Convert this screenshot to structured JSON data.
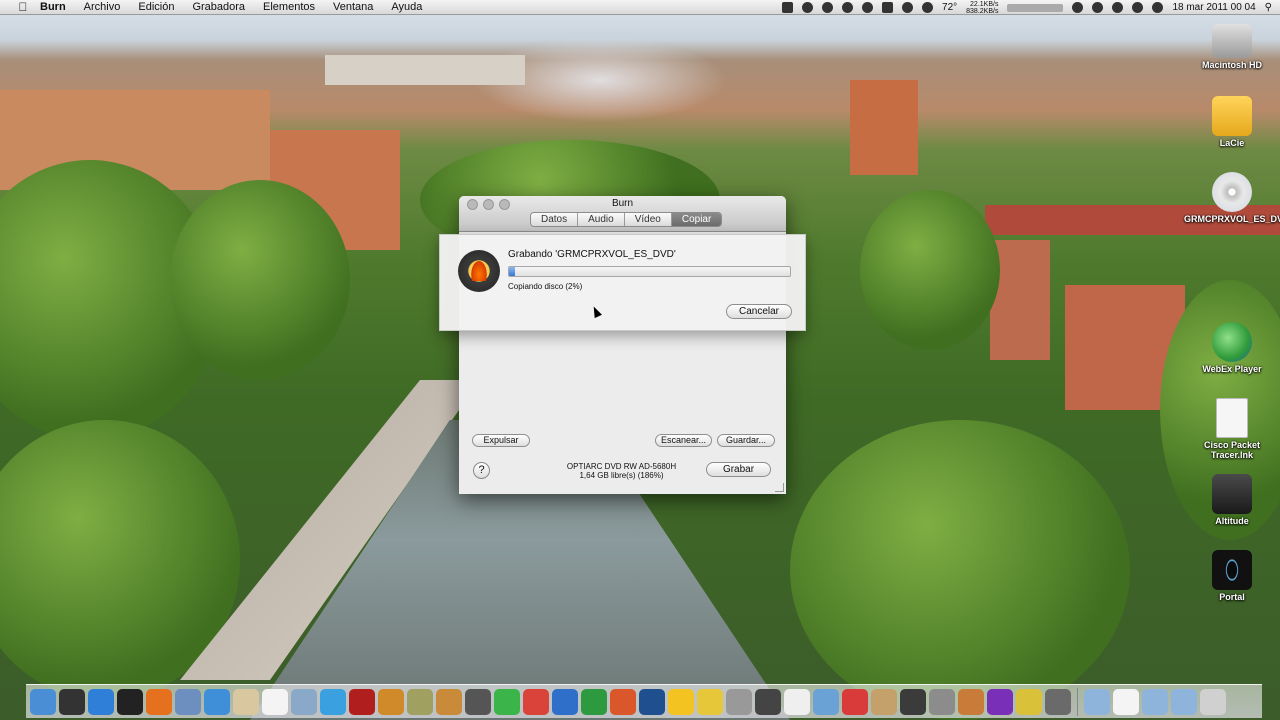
{
  "menubar": {
    "app_name": "Burn",
    "menus": [
      "Archivo",
      "Edición",
      "Grabadora",
      "Elementos",
      "Ventana",
      "Ayuda"
    ],
    "temperature": "72°",
    "net_up": "22.1KB/s",
    "net_down": "838.2KB/s",
    "clock": "18 mar 2011 00 04"
  },
  "desktop_icons": [
    {
      "label": "Macintosh HD",
      "icon": "hard-drive-icon",
      "color": "#c9c9c9"
    },
    {
      "label": "LaCie",
      "icon": "external-drive-icon",
      "color": "#f2c230"
    },
    {
      "label": "GRMCPRXVOL_ES_DVD",
      "icon": "dvd-disc-icon",
      "color": "#e0e0e0"
    },
    {
      "label": "WebEx Player",
      "icon": "webex-icon",
      "color": "#3b9e3e"
    },
    {
      "label": "Cisco Packet Tracer.lnk",
      "icon": "document-icon",
      "color": "#f4f4f4"
    },
    {
      "label": "Altitude",
      "icon": "steam-icon",
      "color": "#2b2b2b"
    },
    {
      "label": "Portal",
      "icon": "portal-icon",
      "color": "#1a1a1a"
    }
  ],
  "burn_window": {
    "title": "Burn",
    "tabs": [
      "Datos",
      "Audio",
      "Vídeo",
      "Copiar"
    ],
    "active_tab": "Copiar",
    "eject_label": "Expulsar",
    "scan_label": "Escanear...",
    "save_label": "Guardar...",
    "help_label": "?",
    "drive_name": "OPTIARC DVD RW AD-5680H",
    "drive_free": "1,64 GB libre(s) (186%)",
    "burn_label": "Grabar"
  },
  "progress_sheet": {
    "title": "Grabando 'GRMCPRXVOL_ES_DVD'",
    "status": "Copiando disco (2%)",
    "progress_percent": 2,
    "cancel_label": "Cancelar"
  },
  "dock": {
    "items": [
      {
        "name": "finder-icon",
        "color": "#4a8fd6"
      },
      {
        "name": "dashboard-icon",
        "color": "#333333"
      },
      {
        "name": "app-store-icon",
        "color": "#2f7fd8"
      },
      {
        "name": "steam-dock-icon",
        "color": "#222222"
      },
      {
        "name": "firefox-icon",
        "color": "#e5711f"
      },
      {
        "name": "preview-icon",
        "color": "#6d8fbf"
      },
      {
        "name": "safari-icon",
        "color": "#3f8ed8"
      },
      {
        "name": "script-icon",
        "color": "#d9c7a0"
      },
      {
        "name": "calendar-icon",
        "color": "#f4f4f4"
      },
      {
        "name": "photos-icon",
        "color": "#8aa8c8"
      },
      {
        "name": "itunes-icon",
        "color": "#3ba0e0"
      },
      {
        "name": "book-icon",
        "color": "#b01e1e"
      },
      {
        "name": "photo-booth-icon",
        "color": "#d08a2a"
      },
      {
        "name": "star-app-icon",
        "color": "#a0a060"
      },
      {
        "name": "guitar-icon",
        "color": "#c98b3a"
      },
      {
        "name": "chip-icon",
        "color": "#555555"
      },
      {
        "name": "spotify-icon",
        "color": "#3bb54a"
      },
      {
        "name": "chrome-icon",
        "color": "#d9433a"
      },
      {
        "name": "word-icon",
        "color": "#2f6fc9"
      },
      {
        "name": "excel-icon",
        "color": "#2e9a3f"
      },
      {
        "name": "powerpoint-icon",
        "color": "#d9572a"
      },
      {
        "name": "photoshop-icon",
        "color": "#1f4f8f"
      },
      {
        "name": "ooo-icon",
        "color": "#f3c322"
      },
      {
        "name": "burn-dock-icon",
        "color": "#e7c73a"
      },
      {
        "name": "network-icon",
        "color": "#999999"
      },
      {
        "name": "flash-icon",
        "color": "#444444"
      },
      {
        "name": "text-doc-icon",
        "color": "#efefef"
      },
      {
        "name": "display-icon",
        "color": "#6aa2d6"
      },
      {
        "name": "parallels-icon",
        "color": "#d93a3a"
      },
      {
        "name": "cup-icon",
        "color": "#c4a06a"
      },
      {
        "name": "camera-icon",
        "color": "#3b3b3b"
      },
      {
        "name": "disk-utility-icon",
        "color": "#8c8c8c"
      },
      {
        "name": "basket-icon",
        "color": "#c97c3a"
      },
      {
        "name": "purple-app-icon",
        "color": "#7a2fb8"
      },
      {
        "name": "radiation-icon",
        "color": "#d9c13a"
      },
      {
        "name": "clapper-icon",
        "color": "#6a6a6a"
      }
    ],
    "right_items": [
      {
        "name": "applications-folder-icon",
        "color": "#8fb4dc"
      },
      {
        "name": "document-stack-icon",
        "color": "#f4f4f4"
      },
      {
        "name": "downloads-folder-icon",
        "color": "#8fb4dc"
      },
      {
        "name": "folder-icon",
        "color": "#8fb4dc"
      },
      {
        "name": "trash-icon",
        "color": "#d0d0d0"
      }
    ]
  }
}
